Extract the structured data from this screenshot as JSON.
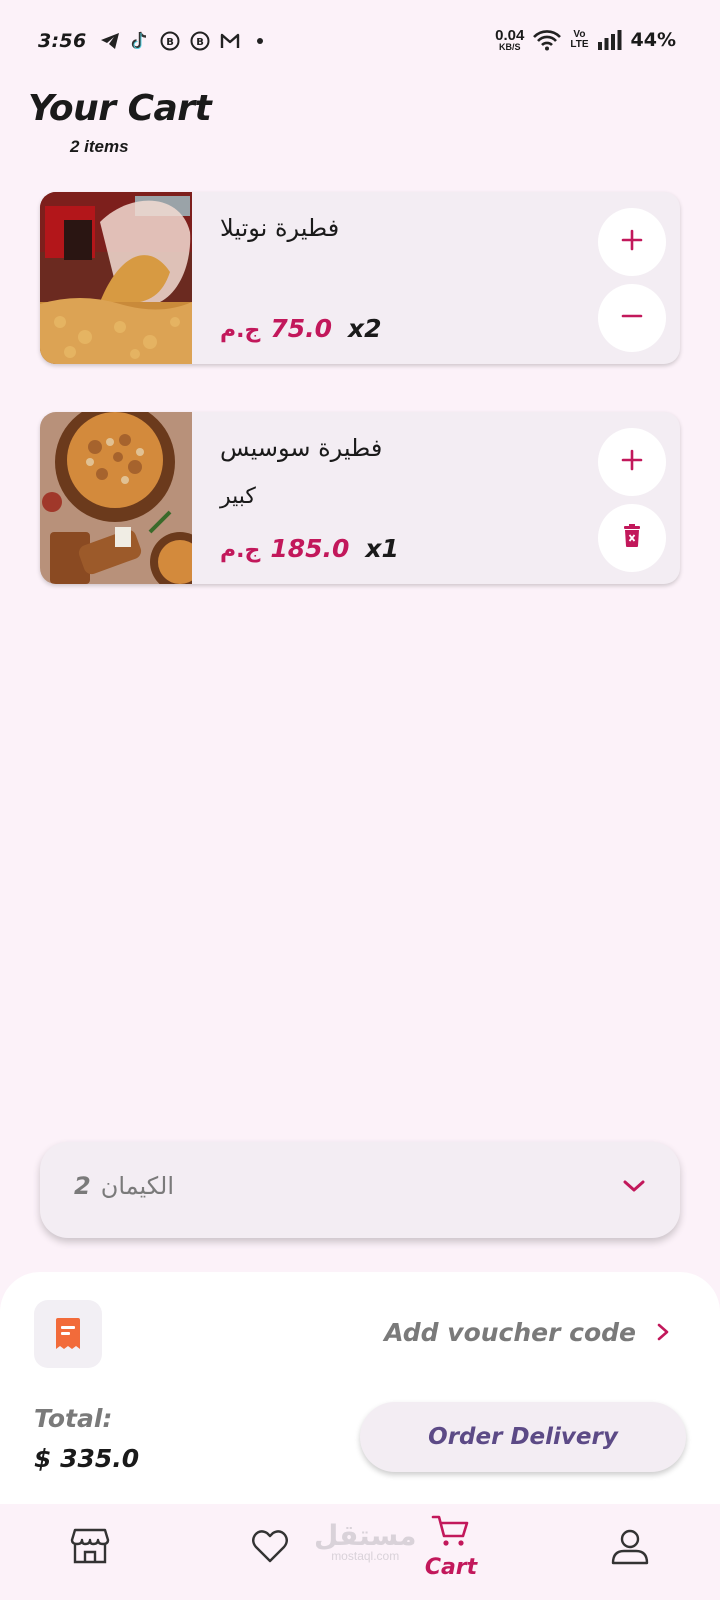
{
  "status_bar": {
    "time": "3:56",
    "net_speed_value": "0.04",
    "net_speed_unit": "KB/S",
    "volte_top": "Vo",
    "volte_bottom": "LTE",
    "battery": "44%",
    "icons": [
      "telegram-icon",
      "tiktok-icon",
      "coin-icon",
      "coin-icon",
      "gmail-icon",
      "dot-icon",
      "wifi-icon",
      "signal-icon"
    ]
  },
  "header": {
    "title": "Your Cart",
    "subtitle": "2 items"
  },
  "cart": {
    "items": [
      {
        "name": "فطيرة نوتيلا",
        "size": "",
        "price": "75.0",
        "currency": "ج.م",
        "quantity": "x2",
        "top_action": "plus-icon",
        "bottom_action": "minus-icon"
      },
      {
        "name": "فطيرة سوسيس",
        "size": "كبير",
        "price": "185.0",
        "currency": "ج.م",
        "quantity": "x1",
        "top_action": "plus-icon",
        "bottom_action": "delete-icon"
      }
    ]
  },
  "branch": {
    "name": "الكيمان",
    "number": "2"
  },
  "checkout": {
    "voucher_label": "Add voucher code",
    "total_label": "Total:",
    "total_value": "$ 335.0",
    "order_button": "Order Delivery"
  },
  "nav": {
    "cart_label": "Cart",
    "watermark_ar": "مستقل",
    "watermark_en": "mostaql.com"
  },
  "colors": {
    "accent": "#c2185b",
    "background": "#fcf2f9",
    "card": "#f3edf3",
    "voucher_icon": "#f26b3a",
    "order_text": "#5c4a86"
  }
}
